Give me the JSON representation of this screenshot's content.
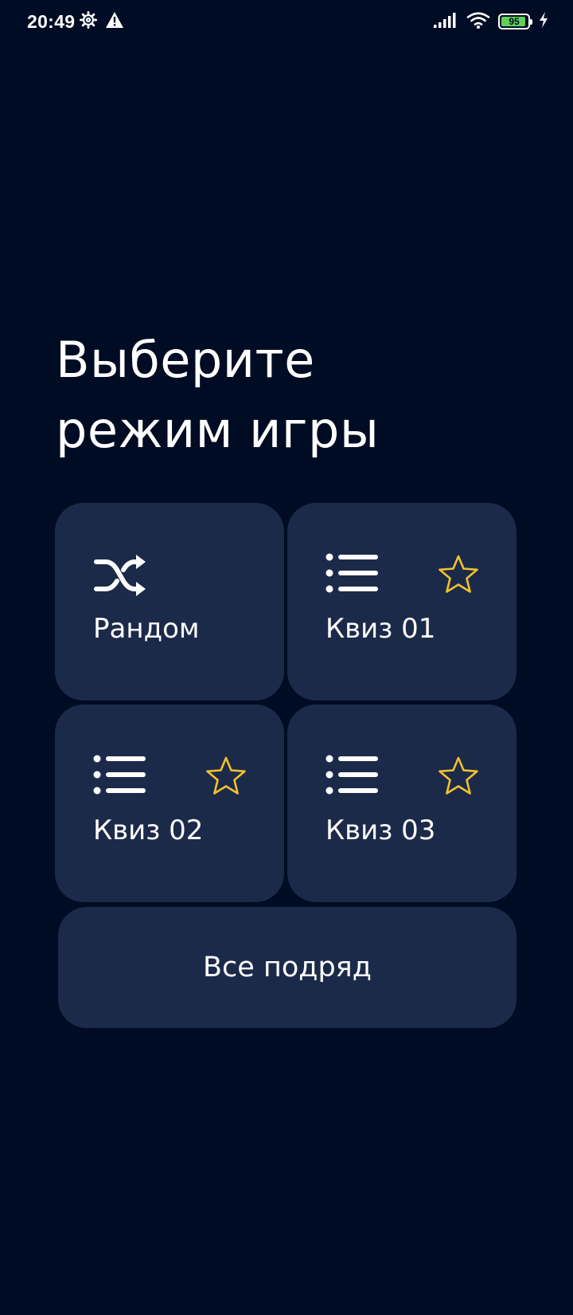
{
  "status_bar": {
    "time": "20:49",
    "battery_level": "95",
    "left_icons": [
      "settings-gear-icon",
      "warning-icon"
    ],
    "right_icons": [
      "signal-icon",
      "wifi-icon",
      "battery-icon",
      "charging-bolt-icon"
    ]
  },
  "title": {
    "line1": "Выберите",
    "line2": "режим игры"
  },
  "modes": [
    {
      "label": "Рандом",
      "icon": "shuffle-icon",
      "favorite": false
    },
    {
      "label": "Квиз 01",
      "icon": "list-icon",
      "favorite": true
    },
    {
      "label": "Квиз 02",
      "icon": "list-icon",
      "favorite": true
    },
    {
      "label": "Квиз 03",
      "icon": "list-icon",
      "favorite": true
    }
  ],
  "all_button": {
    "label": "Все подряд"
  },
  "colors": {
    "background": "#000c23",
    "card": "#1c2a4a",
    "star": "#f2c12e",
    "text": "#ffffff",
    "battery_fill": "#5fd15a"
  }
}
